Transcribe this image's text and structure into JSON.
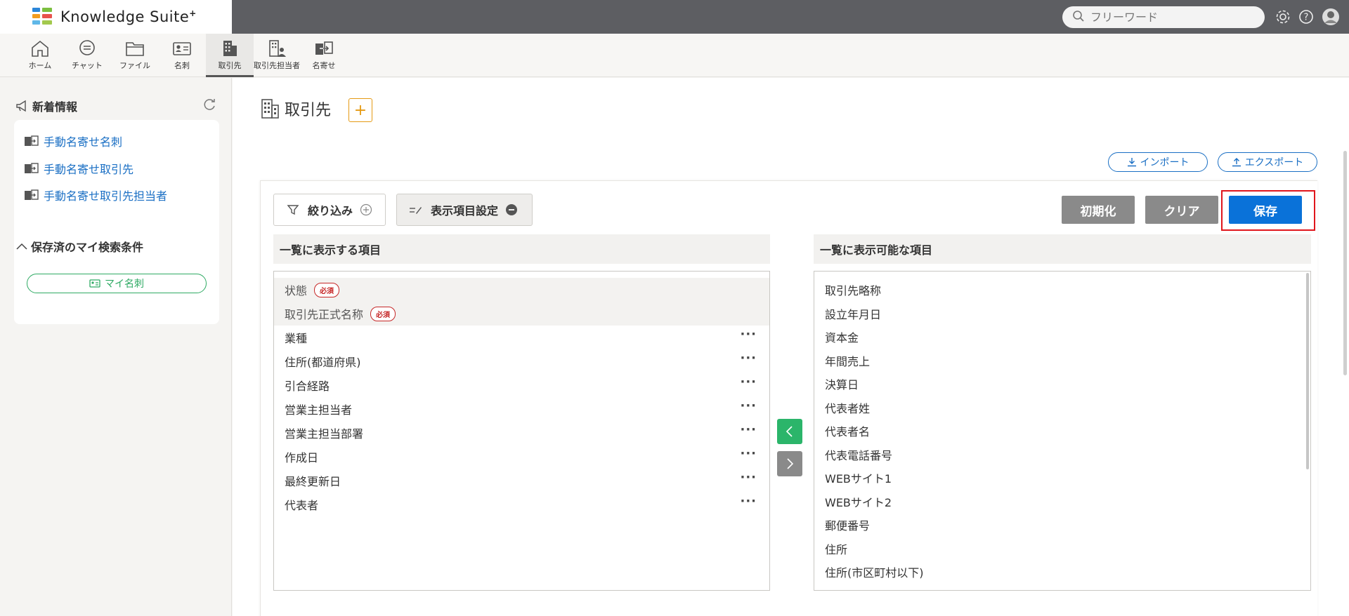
{
  "app": {
    "name": "Knowledge Suite",
    "name_suffix": "+"
  },
  "search": {
    "placeholder": "フリーワード"
  },
  "nav": {
    "items": [
      {
        "label": "ホーム",
        "icon": "home-icon"
      },
      {
        "label": "チャット",
        "icon": "chat-icon"
      },
      {
        "label": "ファイル",
        "icon": "folder-icon"
      },
      {
        "label": "名刺",
        "icon": "business-card-icon"
      },
      {
        "label": "取引先",
        "icon": "building-icon",
        "active": true
      },
      {
        "label": "取引先担当者",
        "icon": "building-person-icon"
      },
      {
        "label": "名寄せ",
        "icon": "merge-icon"
      }
    ]
  },
  "sidebar": {
    "news_title": "新着情報",
    "news_links": [
      "手動名寄せ名刺",
      "手動名寄せ取引先",
      "手動名寄せ取引先担当者"
    ],
    "saved_title": "保存済のマイ検索条件",
    "saved_pill": "マイ名刺"
  },
  "main": {
    "title": "取引先",
    "add_label": "+",
    "import_label": "インポート",
    "export_label": "エクスポート",
    "filter_label": "絞り込み",
    "colset_label": "表示項目設定",
    "reset_label": "初期化",
    "clear_label": "クリア",
    "save_label": "保存",
    "left_header": "一覧に表示する項目",
    "right_header": "一覧に表示可能な項目",
    "required_badge": "必須",
    "more_label": "···",
    "required_items": [
      "状態",
      "取引先正式名称"
    ],
    "display_items": [
      "業種",
      "住所(都道府県)",
      "引合経路",
      "営業主担当者",
      "営業主担当部署",
      "作成日",
      "最終更新日",
      "代表者"
    ],
    "available_items": [
      "取引先略称",
      "設立年月日",
      "資本金",
      "年間売上",
      "決算日",
      "代表者姓",
      "代表者名",
      "代表電話番号",
      "WEBサイト1",
      "WEBサイト2",
      "郵便番号",
      "住所",
      "住所(市区町村以下)"
    ]
  },
  "colors": {
    "accent_blue": "#0a72d9",
    "link_blue": "#1a6fc4",
    "green": "#2eaa63",
    "orange": "#e59a14",
    "required_red": "#c62828",
    "highlight_red": "#e0151c"
  }
}
